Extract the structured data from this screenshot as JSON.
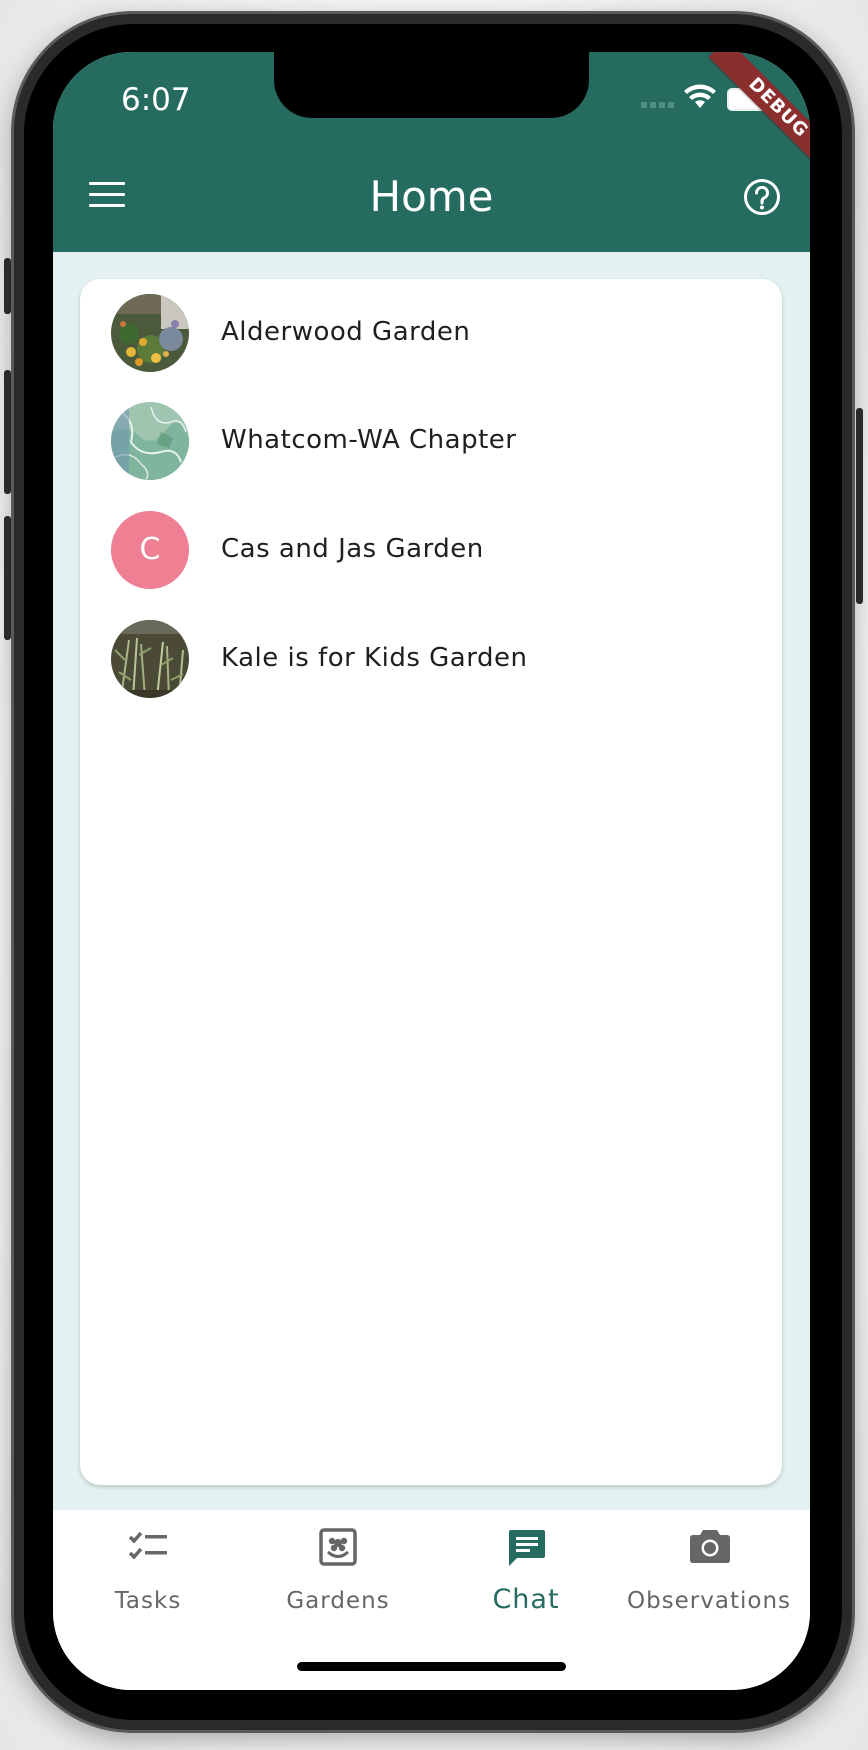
{
  "status_bar": {
    "time": "6:07",
    "debug_banner": "DEBUG"
  },
  "app_bar": {
    "title": "Home",
    "menu_icon": "menu-icon",
    "help_icon": "help-circle-icon",
    "background_color": "#266b60"
  },
  "chat_list": {
    "items": [
      {
        "label": "Alderwood Garden",
        "avatar": "photo-flowers"
      },
      {
        "label": "Whatcom-WA Chapter",
        "avatar": "photo-map"
      },
      {
        "label": "Cas and Jas Garden",
        "avatar_letter": "C",
        "avatar_color": "#ef7f92"
      },
      {
        "label": "Kale is for Kids Garden",
        "avatar": "photo-garden-bed"
      }
    ]
  },
  "bottom_nav": {
    "items": [
      {
        "label": "Tasks",
        "icon": "checklist-icon",
        "active": false
      },
      {
        "label": "Gardens",
        "icon": "garden-icon",
        "active": false
      },
      {
        "label": "Chat",
        "icon": "chat-icon",
        "active": true
      },
      {
        "label": "Observations",
        "icon": "camera-icon",
        "active": false
      }
    ],
    "active_color": "#266b60",
    "inactive_color": "#666666"
  }
}
